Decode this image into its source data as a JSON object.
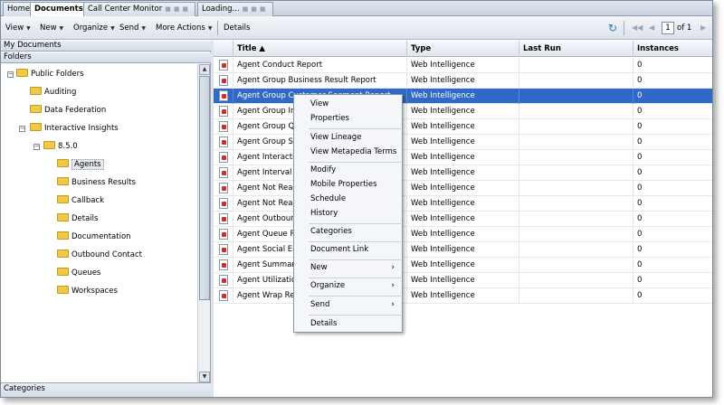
{
  "tabs": [
    {
      "label": "Home"
    },
    {
      "label": "Documents"
    },
    {
      "label": "Call Center Monitor"
    },
    {
      "label": "Loading..."
    }
  ],
  "toolbar": {
    "view": "View",
    "new": "New",
    "organize": "Organize",
    "send": "Send",
    "more_actions": "More Actions",
    "details": "Details",
    "page_value": "1",
    "page_of": "of 1"
  },
  "left": {
    "my_documents": "My Documents",
    "folders": "Folders",
    "categories": "Categories",
    "tree": [
      {
        "label": "Public Folders"
      },
      {
        "label": "Auditing"
      },
      {
        "label": "Data Federation"
      },
      {
        "label": "Interactive Insights"
      },
      {
        "label": "8.5.0"
      },
      {
        "label": "Agents"
      },
      {
        "label": "Business Results"
      },
      {
        "label": "Callback"
      },
      {
        "label": "Details"
      },
      {
        "label": "Documentation"
      },
      {
        "label": "Outbound Contact"
      },
      {
        "label": "Queues"
      },
      {
        "label": "Workspaces"
      }
    ]
  },
  "grid": {
    "columns": [
      "Title ▲",
      "Type",
      "Last Run",
      "Instances"
    ],
    "rows": [
      {
        "title": "Agent Conduct Report",
        "type": "Web Intelligence",
        "last_run": "",
        "instances": "0"
      },
      {
        "title": "Agent Group Business Result Report",
        "type": "Web Intelligence",
        "last_run": "",
        "instances": "0"
      },
      {
        "title": "Agent Group Customer Segment Report",
        "type": "Web Intelligence",
        "last_run": "",
        "instances": "0"
      },
      {
        "title": "Agent Group Interval Report",
        "type": "Web Intelligence",
        "last_run": "",
        "instances": "0"
      },
      {
        "title": "Agent Group Queue Report",
        "type": "Web Intelligence",
        "last_run": "",
        "instances": "0"
      },
      {
        "title": "Agent Group Service Report",
        "type": "Web Intelligence",
        "last_run": "",
        "instances": "0"
      },
      {
        "title": "Agent Interaction Report",
        "type": "Web Intelligence",
        "last_run": "",
        "instances": "0"
      },
      {
        "title": "Agent Interval Based Report",
        "type": "Web Intelligence",
        "last_run": "",
        "instances": "0"
      },
      {
        "title": "Agent Not Ready Report",
        "type": "Web Intelligence",
        "last_run": "",
        "instances": "0"
      },
      {
        "title": "Agent Not Ready Reason Report",
        "type": "Web Intelligence",
        "last_run": "",
        "instances": "0"
      },
      {
        "title": "Agent Outbound Report",
        "type": "Web Intelligence",
        "last_run": "",
        "instances": "0"
      },
      {
        "title": "Agent Queue Report",
        "type": "Web Intelligence",
        "last_run": "",
        "instances": "0"
      },
      {
        "title": "Agent Social Engagement Report",
        "type": "Web Intelligence",
        "last_run": "",
        "instances": "0"
      },
      {
        "title": "Agent Summary Report",
        "type": "Web Intelligence",
        "last_run": "",
        "instances": "0"
      },
      {
        "title": "Agent Utilization Report",
        "type": "Web Intelligence",
        "last_run": "",
        "instances": "0"
      },
      {
        "title": "Agent Wrap Report",
        "type": "Web Intelligence",
        "last_run": "",
        "instances": "0"
      }
    ]
  },
  "context_menu": {
    "view": "View",
    "properties": "Properties",
    "view_lineage": "View Lineage",
    "view_metapedia": "View Metapedia Terms",
    "modify": "Modify",
    "mobile_properties": "Mobile Properties",
    "schedule": "Schedule",
    "history": "History",
    "categories": "Categories",
    "document_link": "Document Link",
    "new": "New",
    "organize": "Organize",
    "send": "Send",
    "details": "Details",
    "submenu_arrow": "›"
  }
}
